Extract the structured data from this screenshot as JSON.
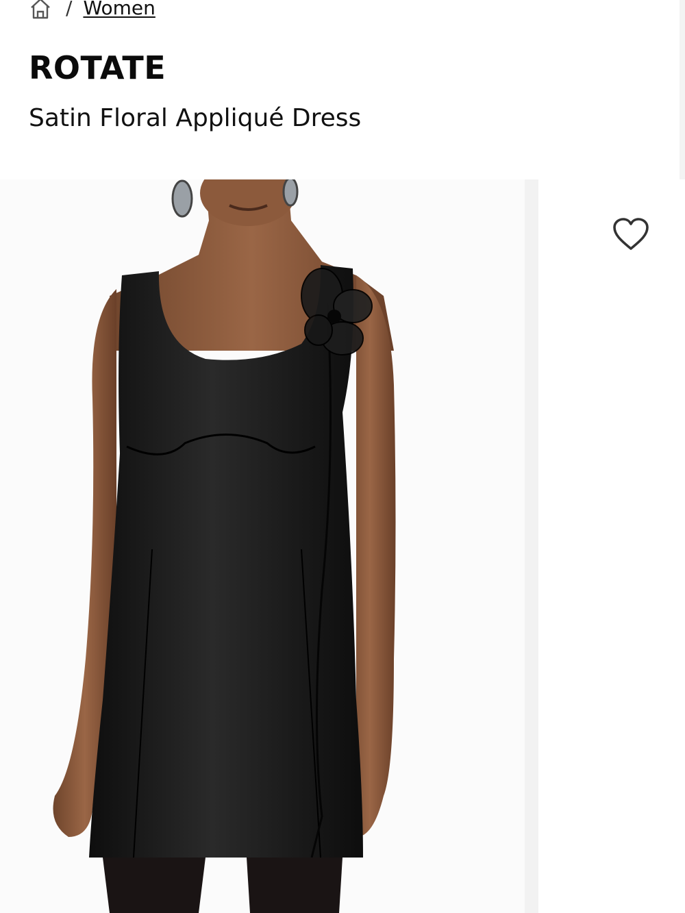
{
  "breadcrumb": {
    "home_icon": "home-icon",
    "separator": "/",
    "current": "Women"
  },
  "product": {
    "brand": "ROTATE",
    "name": "Satin Floral Appliqué Dress"
  },
  "gallery": {
    "main_image": "model-wearing-black-satin-mini-dress-with-sheer-flower-applique",
    "wishlist_icon": "heart-outline-icon"
  },
  "colors": {
    "text": "#111111",
    "dress": "#151515",
    "skin": "#8a5a3c"
  }
}
